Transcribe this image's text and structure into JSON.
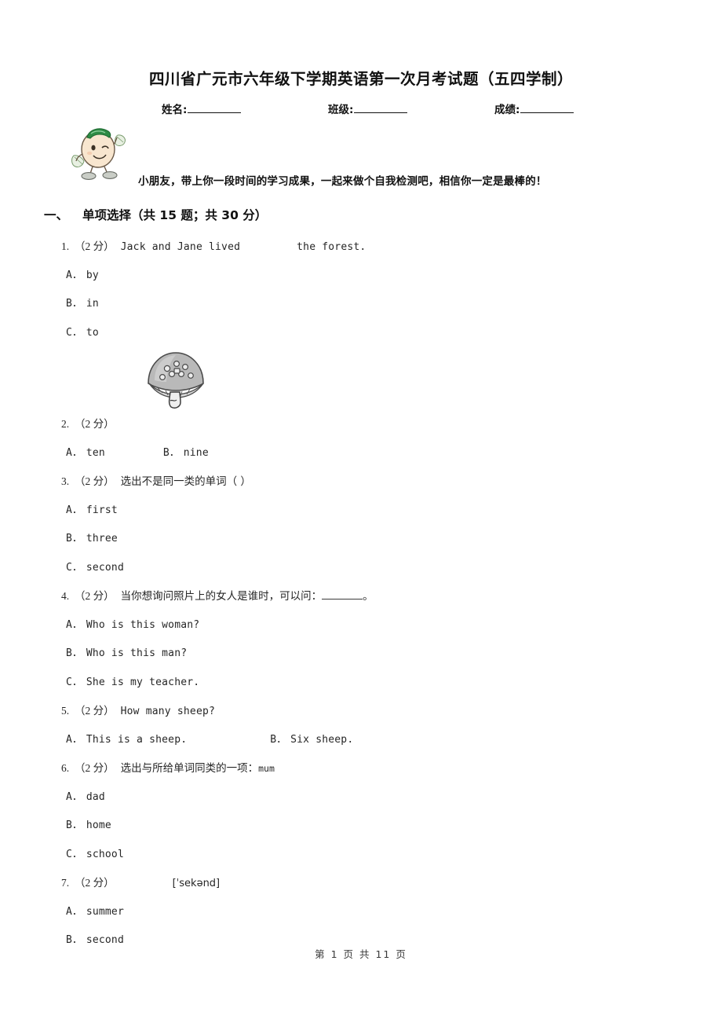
{
  "document": {
    "title": "四川省广元市六年级下学期英语第一次月考试题（五四学制）",
    "intro_text": "小朋友，带上你一段时间的学习成果，一起来做个自我检测吧，相信你一定是最棒的！",
    "mascot_alt": "cartoon-kid-mascot"
  },
  "meta": {
    "name_label": "姓名:",
    "class_label": "班级:",
    "score_label": "成绩:"
  },
  "section": {
    "number": "一、",
    "title": "单项选择",
    "meta": "（共 15 题；共 30 分）"
  },
  "questions": [
    {
      "num": "1.",
      "points": "（2 分）",
      "stem_before": "Jack and Jane lived",
      "stem_after": "the forest.",
      "options": [
        {
          "key": "A．",
          "text": "by"
        },
        {
          "key": "B．",
          "text": "in"
        },
        {
          "key": "C．",
          "text": "to"
        }
      ]
    },
    {
      "num": "2.",
      "points": "（2 分）",
      "figure": "mushroom-illustration",
      "options": [
        {
          "key": "A．",
          "text": "ten"
        },
        {
          "key": "B．",
          "text": "nine"
        }
      ]
    },
    {
      "num": "3.",
      "points": "（2 分）",
      "stem": "选出不是同一类的单词（      ）",
      "options": [
        {
          "key": "A．",
          "text": "first"
        },
        {
          "key": "B．",
          "text": "three"
        },
        {
          "key": "C．",
          "text": "second"
        }
      ]
    },
    {
      "num": "4.",
      "points": "（2 分）",
      "stem_before": "当你想询问照片上的女人是谁时，可以问：",
      "stem_after": "。",
      "options": [
        {
          "key": "A．",
          "text": "Who is this woman?"
        },
        {
          "key": "B．",
          "text": "Who is this man?"
        },
        {
          "key": "C．",
          "text": "She is my teacher."
        }
      ]
    },
    {
      "num": "5.",
      "points": "（2 分）",
      "stem": "How many sheep?",
      "options": [
        {
          "key": "A．",
          "text": "This is a sheep."
        },
        {
          "key": "B．",
          "text": "Six sheep."
        }
      ]
    },
    {
      "num": "6.",
      "points": "（2 分）",
      "stem_cn": "选出与所给单词同类的一项：",
      "stem_en": "mum",
      "options": [
        {
          "key": "A．",
          "text": "dad"
        },
        {
          "key": "B．",
          "text": "home"
        },
        {
          "key": "C．",
          "text": "school"
        }
      ]
    },
    {
      "num": "7.",
      "points": "（2 分）",
      "ipa": "[ˈsekənd]",
      "options": [
        {
          "key": "A．",
          "text": "summer"
        },
        {
          "key": "B．",
          "text": "second"
        }
      ]
    }
  ],
  "footer": {
    "text": "第 1 页 共 11 页"
  }
}
